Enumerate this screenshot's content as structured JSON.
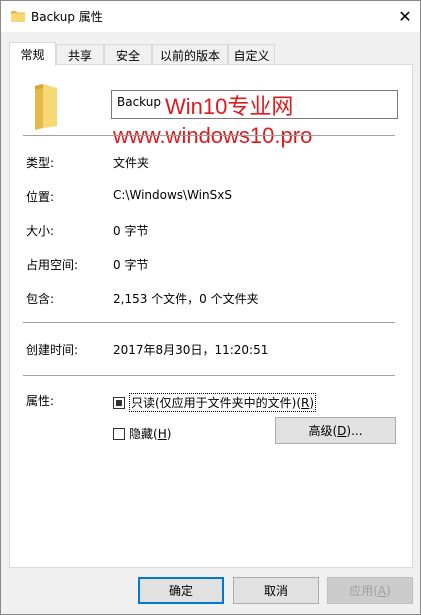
{
  "window": {
    "title": "Backup 属性",
    "close_glyph": "✕"
  },
  "tabs": [
    {
      "label": "常规",
      "active": true
    },
    {
      "label": "共享"
    },
    {
      "label": "安全"
    },
    {
      "label": "以前的版本"
    },
    {
      "label": "自定义"
    }
  ],
  "general": {
    "name_value": "Backup",
    "watermark_line1": "Win10专业网",
    "watermark_line2": "www.windows10.pro",
    "type_label": "类型:",
    "type_value": "文件夹",
    "location_label": "位置:",
    "location_value": "C:\\Windows\\WinSxS",
    "size_label": "大小:",
    "size_value": "0 字节",
    "size_on_disk_label": "占用空间:",
    "size_on_disk_value": "0 字节",
    "contains_label": "包含:",
    "contains_value": "2,153 个文件，0 个文件夹",
    "created_label": "创建时间:",
    "created_value": "2017年8月30日，11:20:51",
    "attributes_label": "属性:",
    "readonly_label": "只读(仅应用于文件夹中的文件)(",
    "readonly_key": "R",
    "readonly_close": ")",
    "hidden_label": "隐藏(",
    "hidden_key": "H",
    "hidden_close": ")",
    "advanced_label": "高级(",
    "advanced_key": "D",
    "advanced_close": ")..."
  },
  "footer": {
    "ok": "确定",
    "cancel": "取消",
    "apply_label": "应用(",
    "apply_key": "A",
    "apply_close": ")"
  },
  "colors": {
    "accent": "#0078d7",
    "watermark": "#e0191e",
    "folder": "#f8d775"
  },
  "icons": {
    "title": "folder-icon",
    "big": "folder-icon",
    "close": "close-icon"
  }
}
